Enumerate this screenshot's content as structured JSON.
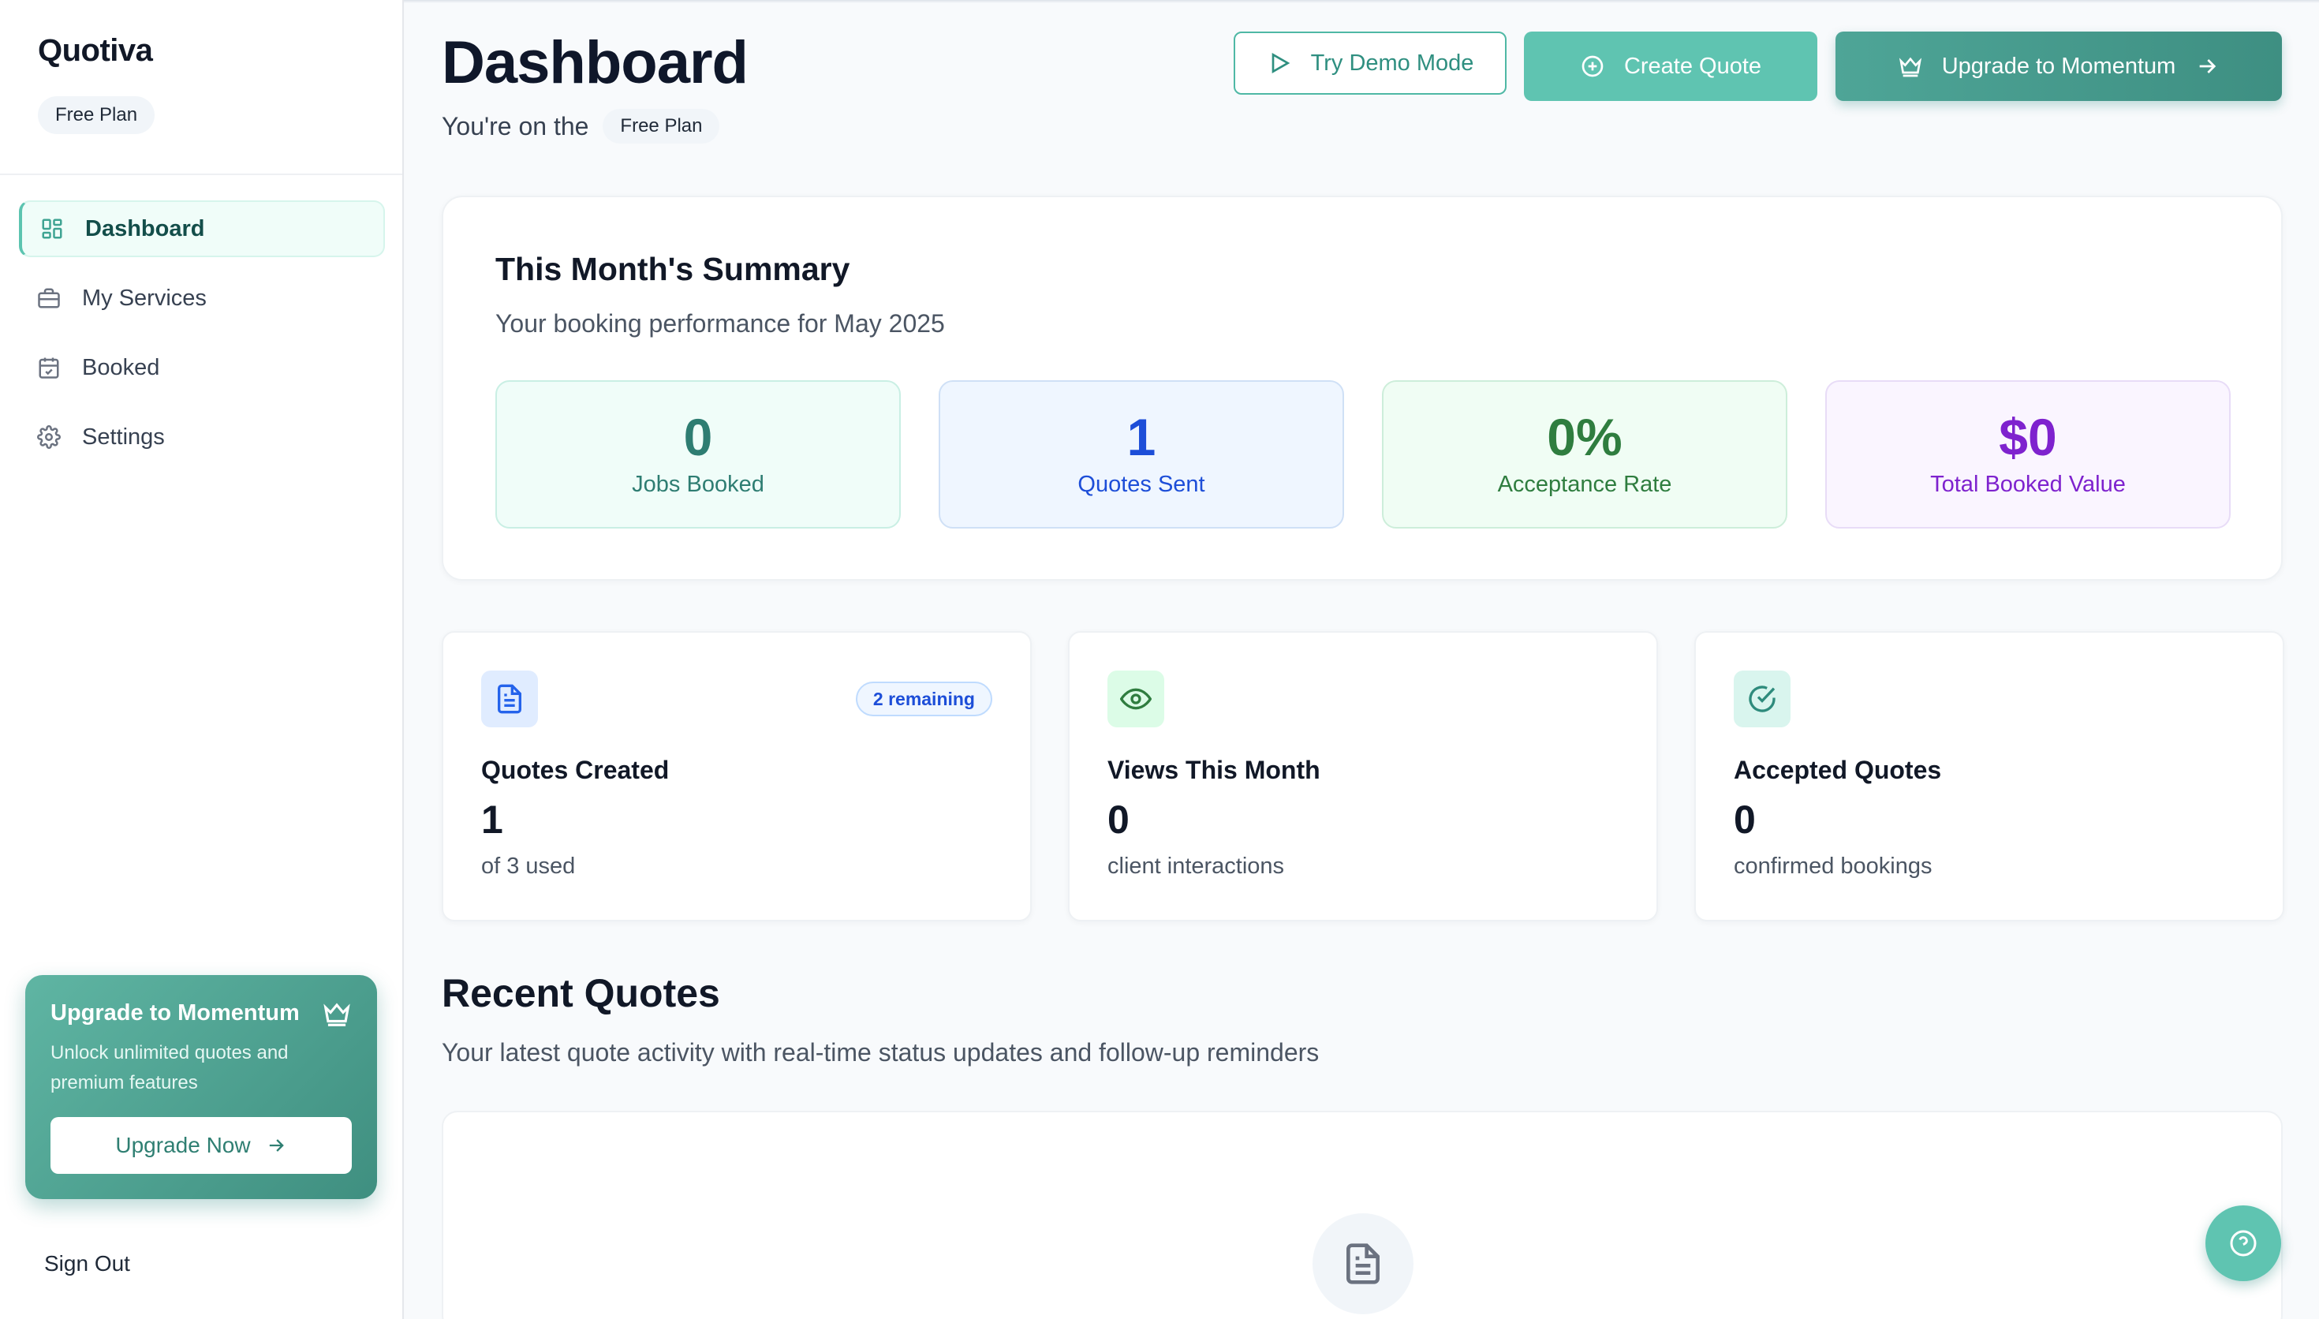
{
  "sidebar": {
    "brand": "Quotiva",
    "plan_badge": "Free Plan",
    "nav": [
      {
        "label": "Dashboard",
        "icon": "dashboard-grid-icon",
        "active": true
      },
      {
        "label": "My Services",
        "icon": "briefcase-icon"
      },
      {
        "label": "Booked",
        "icon": "calendar-check-icon"
      },
      {
        "label": "Settings",
        "icon": "gear-icon"
      }
    ],
    "upgrade_card": {
      "title": "Upgrade to Momentum",
      "description": "Unlock unlimited quotes and premium features",
      "button": "Upgrade Now"
    },
    "sign_out": "Sign Out"
  },
  "header": {
    "title": "Dashboard",
    "plan_prefix": "You're on the",
    "plan_badge": "Free Plan",
    "buttons": {
      "demo": "Try Demo Mode",
      "create": "Create Quote",
      "upgrade": "Upgrade to Momentum"
    }
  },
  "summary": {
    "title": "This Month's Summary",
    "subtitle": "Your booking performance for May 2025",
    "stats": [
      {
        "value": "0",
        "label": "Jobs Booked"
      },
      {
        "value": "1",
        "label": "Quotes Sent"
      },
      {
        "value": "0%",
        "label": "Acceptance Rate"
      },
      {
        "value": "$0",
        "label": "Total Booked Value"
      }
    ]
  },
  "cards": [
    {
      "title": "Quotes Created",
      "value": "1",
      "sub": "of 3 used",
      "badge": "2 remaining",
      "icon": "document-icon"
    },
    {
      "title": "Views This Month",
      "value": "0",
      "sub": "client interactions",
      "icon": "eye-icon"
    },
    {
      "title": "Accepted Quotes",
      "value": "0",
      "sub": "confirmed bookings",
      "icon": "check-circle-icon"
    }
  ],
  "recent": {
    "title": "Recent Quotes",
    "subtitle": "Your latest quote activity with real-time status updates and follow-up reminders"
  },
  "colors": {
    "accent": "#5fc4b1",
    "accent_dark": "#3e8f82",
    "quotes_sent": "#1d4ed8",
    "acceptance": "#2f7d3f",
    "value": "#7e22ce"
  }
}
